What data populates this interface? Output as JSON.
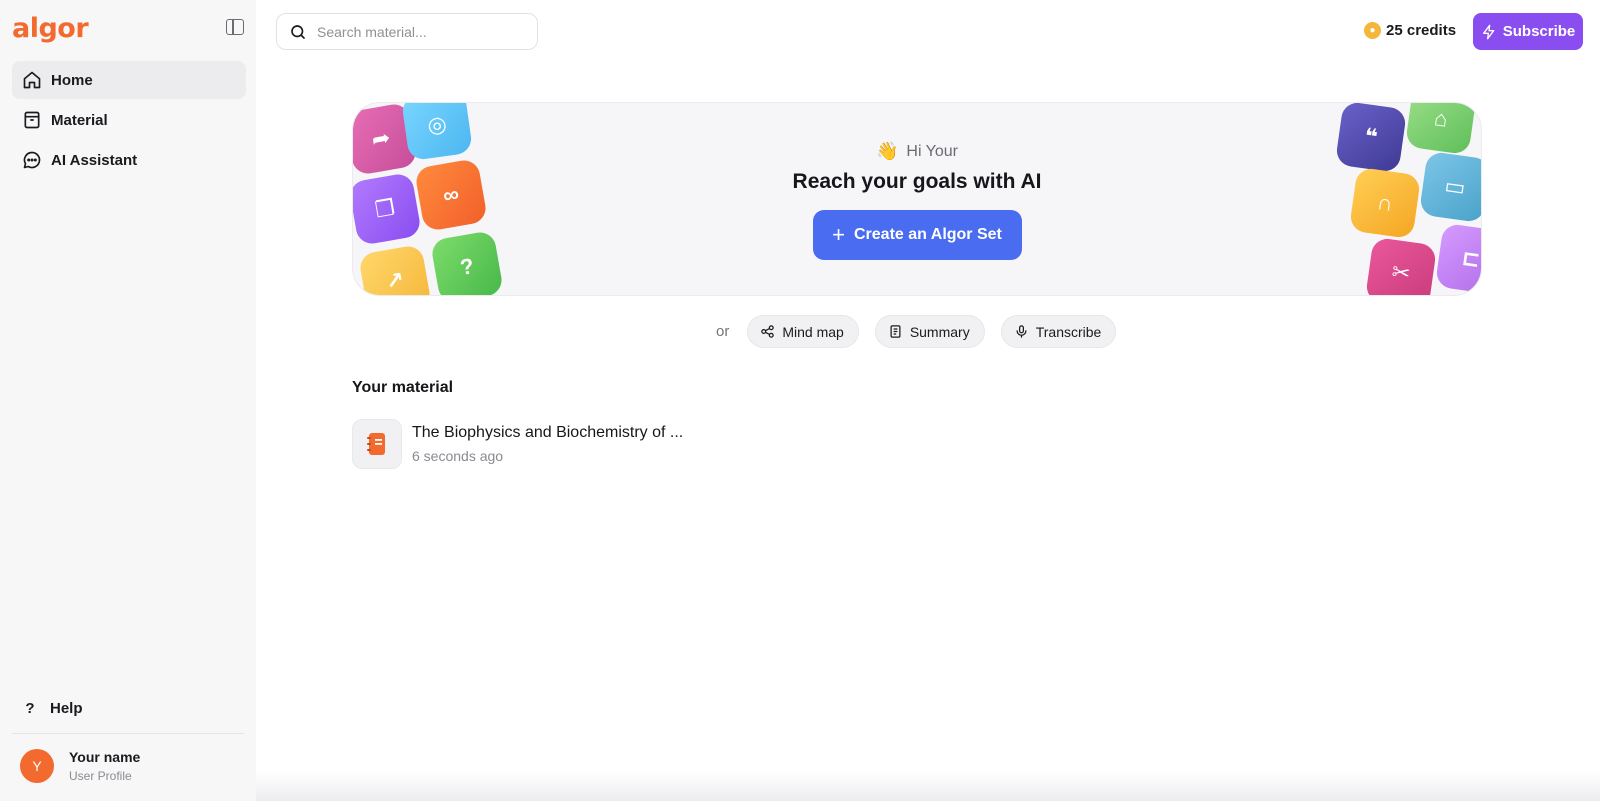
{
  "app": {
    "logo_text": "algor"
  },
  "sidebar": {
    "items": [
      {
        "label": "Home",
        "icon": "home-icon",
        "active": true
      },
      {
        "label": "Material",
        "icon": "archive-icon",
        "active": false
      },
      {
        "label": "AI Assistant",
        "icon": "chat-icon",
        "active": false
      }
    ],
    "help_label": "Help",
    "help_icon_glyph": "?",
    "profile": {
      "initial": "Y",
      "name": "Your name",
      "subtitle": "User Profile"
    }
  },
  "header": {
    "search_placeholder": "Search material...",
    "credits_label": "25 credits",
    "subscribe_label": "Subscribe"
  },
  "hero": {
    "greeting": "Hi Your",
    "headline": "Reach your goals with AI",
    "create_label": "Create an Algor Set"
  },
  "tools": {
    "or_label": "or",
    "chips": [
      {
        "label": "Mind map",
        "icon": "mind-map-icon"
      },
      {
        "label": "Summary",
        "icon": "summary-icon"
      },
      {
        "label": "Transcribe",
        "icon": "microphone-icon"
      }
    ]
  },
  "material": {
    "section_title": "Your material",
    "items": [
      {
        "title": "The Biophysics and Biochemistry of ...",
        "time": "6 seconds ago",
        "icon": "notebook-icon"
      }
    ]
  },
  "colors": {
    "brand": "#f26a2e",
    "primary": "#4a6cf0",
    "subscribe": "#8a4df0",
    "coin": "#f5b73b"
  }
}
